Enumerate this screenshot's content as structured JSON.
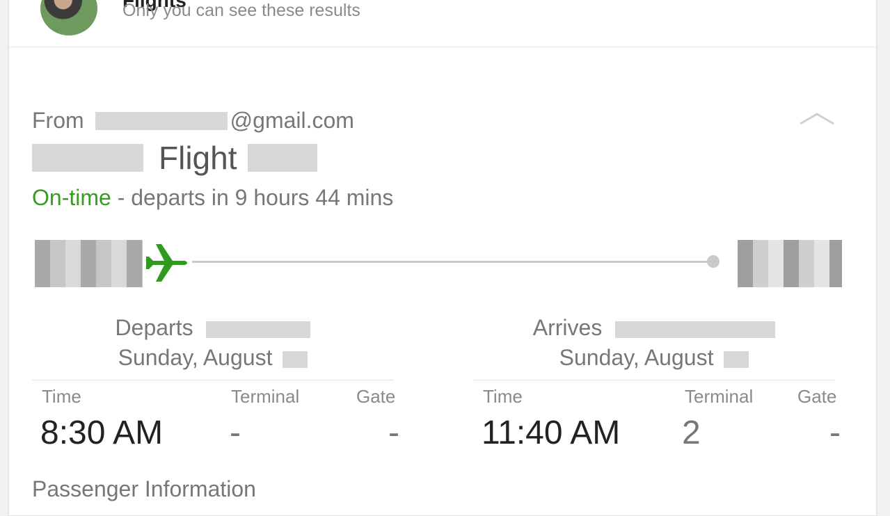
{
  "header": {
    "title": "Flights",
    "subtitle": "Only you can see these results"
  },
  "card": {
    "from_label": "From",
    "from_email_suffix": "@gmail.com",
    "flight_word": "Flight",
    "status": {
      "ontime": "On-time",
      "rest": " - departs in 9 hours 44 mins"
    }
  },
  "departs": {
    "label": "Departs",
    "date": "Sunday, August",
    "time_label": "Time",
    "terminal_label": "Terminal",
    "gate_label": "Gate",
    "time": "8:30 AM",
    "terminal": "-",
    "gate": "-"
  },
  "arrives": {
    "label": "Arrives",
    "date": "Sunday, August",
    "time_label": "Time",
    "terminal_label": "Terminal",
    "gate_label": "Gate",
    "time": "11:40 AM",
    "terminal": "2",
    "gate": "-"
  },
  "passenger_heading": "Passenger Information",
  "colors": {
    "ontime": "#3a9b23",
    "plane": "#2f9a1e"
  },
  "icons": {
    "plane": "plane-icon",
    "collapse": "chevron-up-icon"
  }
}
